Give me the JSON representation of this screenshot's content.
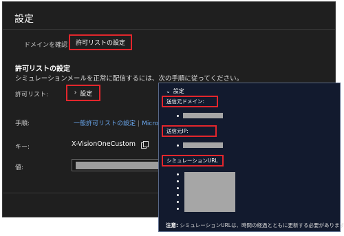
{
  "header": {
    "title": "設定"
  },
  "tabs": [
    {
      "label": "ドメインを確認"
    },
    {
      "label": "許可リストの設定"
    }
  ],
  "section": {
    "title": "許可リストの設定",
    "description": "シミュレーションメールを正常に配信するには、次の手順に従ってください。"
  },
  "rows": {
    "allowlist_label": "許可リスト:",
    "allowlist_toggle": "設定",
    "steps_label": "手順:",
    "steps_link": "一般許可リストの設定",
    "steps_link2": "Microso",
    "key_label": "キー:",
    "key_value": "X-VisionOneCustom",
    "value_label": "値:"
  },
  "panel": {
    "toggle": "設定",
    "sender_domain_label": "送信元ドメイン:",
    "sender_ip_label": "送信元IP:",
    "sim_url_label": "シミュレーションURL",
    "note_prefix": "注意:",
    "note_text": " シミュレーションURLは、時間の経過とともに更新する必要があります。"
  },
  "colors": {
    "highlight": "#e3262c",
    "link": "#6aa8f0",
    "background": "#1f1f1f",
    "panel_bg": "#121a2e"
  },
  "icons": [
    "chevron-right-icon",
    "copy-icon",
    "chevron-down-icon"
  ]
}
